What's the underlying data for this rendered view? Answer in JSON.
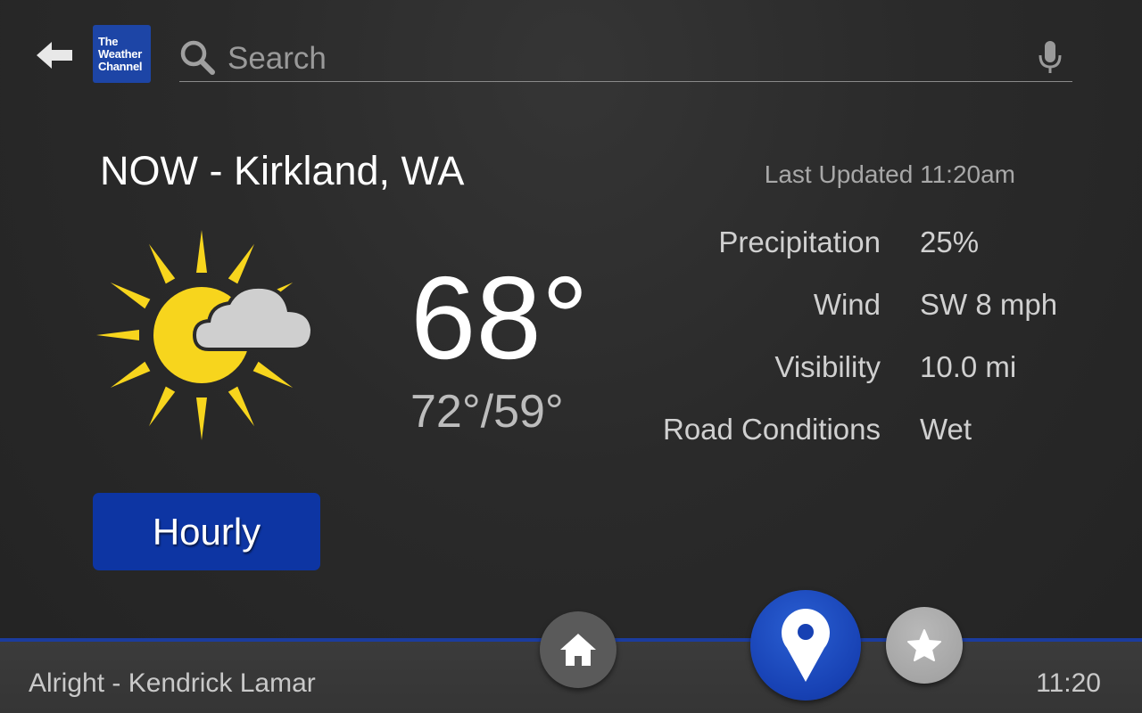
{
  "header": {
    "logo_lines": [
      "The",
      "Weather",
      "Channel"
    ],
    "search_placeholder": "Search"
  },
  "weather": {
    "title": "NOW - Kirkland, WA",
    "last_updated": "Last Updated 11:20am",
    "condition_icon": "partly-sunny-icon",
    "current_temp": "68°",
    "high_low": "72°/59°",
    "details": [
      {
        "label": "Precipitation",
        "value": "25%"
      },
      {
        "label": "Wind",
        "value": "SW 8 mph"
      },
      {
        "label": "Visibility",
        "value": "10.0 mi"
      },
      {
        "label": "Road Conditions",
        "value": "Wet"
      }
    ],
    "hourly_label": "Hourly"
  },
  "bottom_bar": {
    "now_playing": "Alright - Kendrick Lamar",
    "clock": "11:20"
  },
  "colors": {
    "accent_blue": "#1741b3",
    "logo_blue": "#1d45a6",
    "sun_yellow": "#f7d51d",
    "cloud_grey": "#cfcfcf"
  }
}
